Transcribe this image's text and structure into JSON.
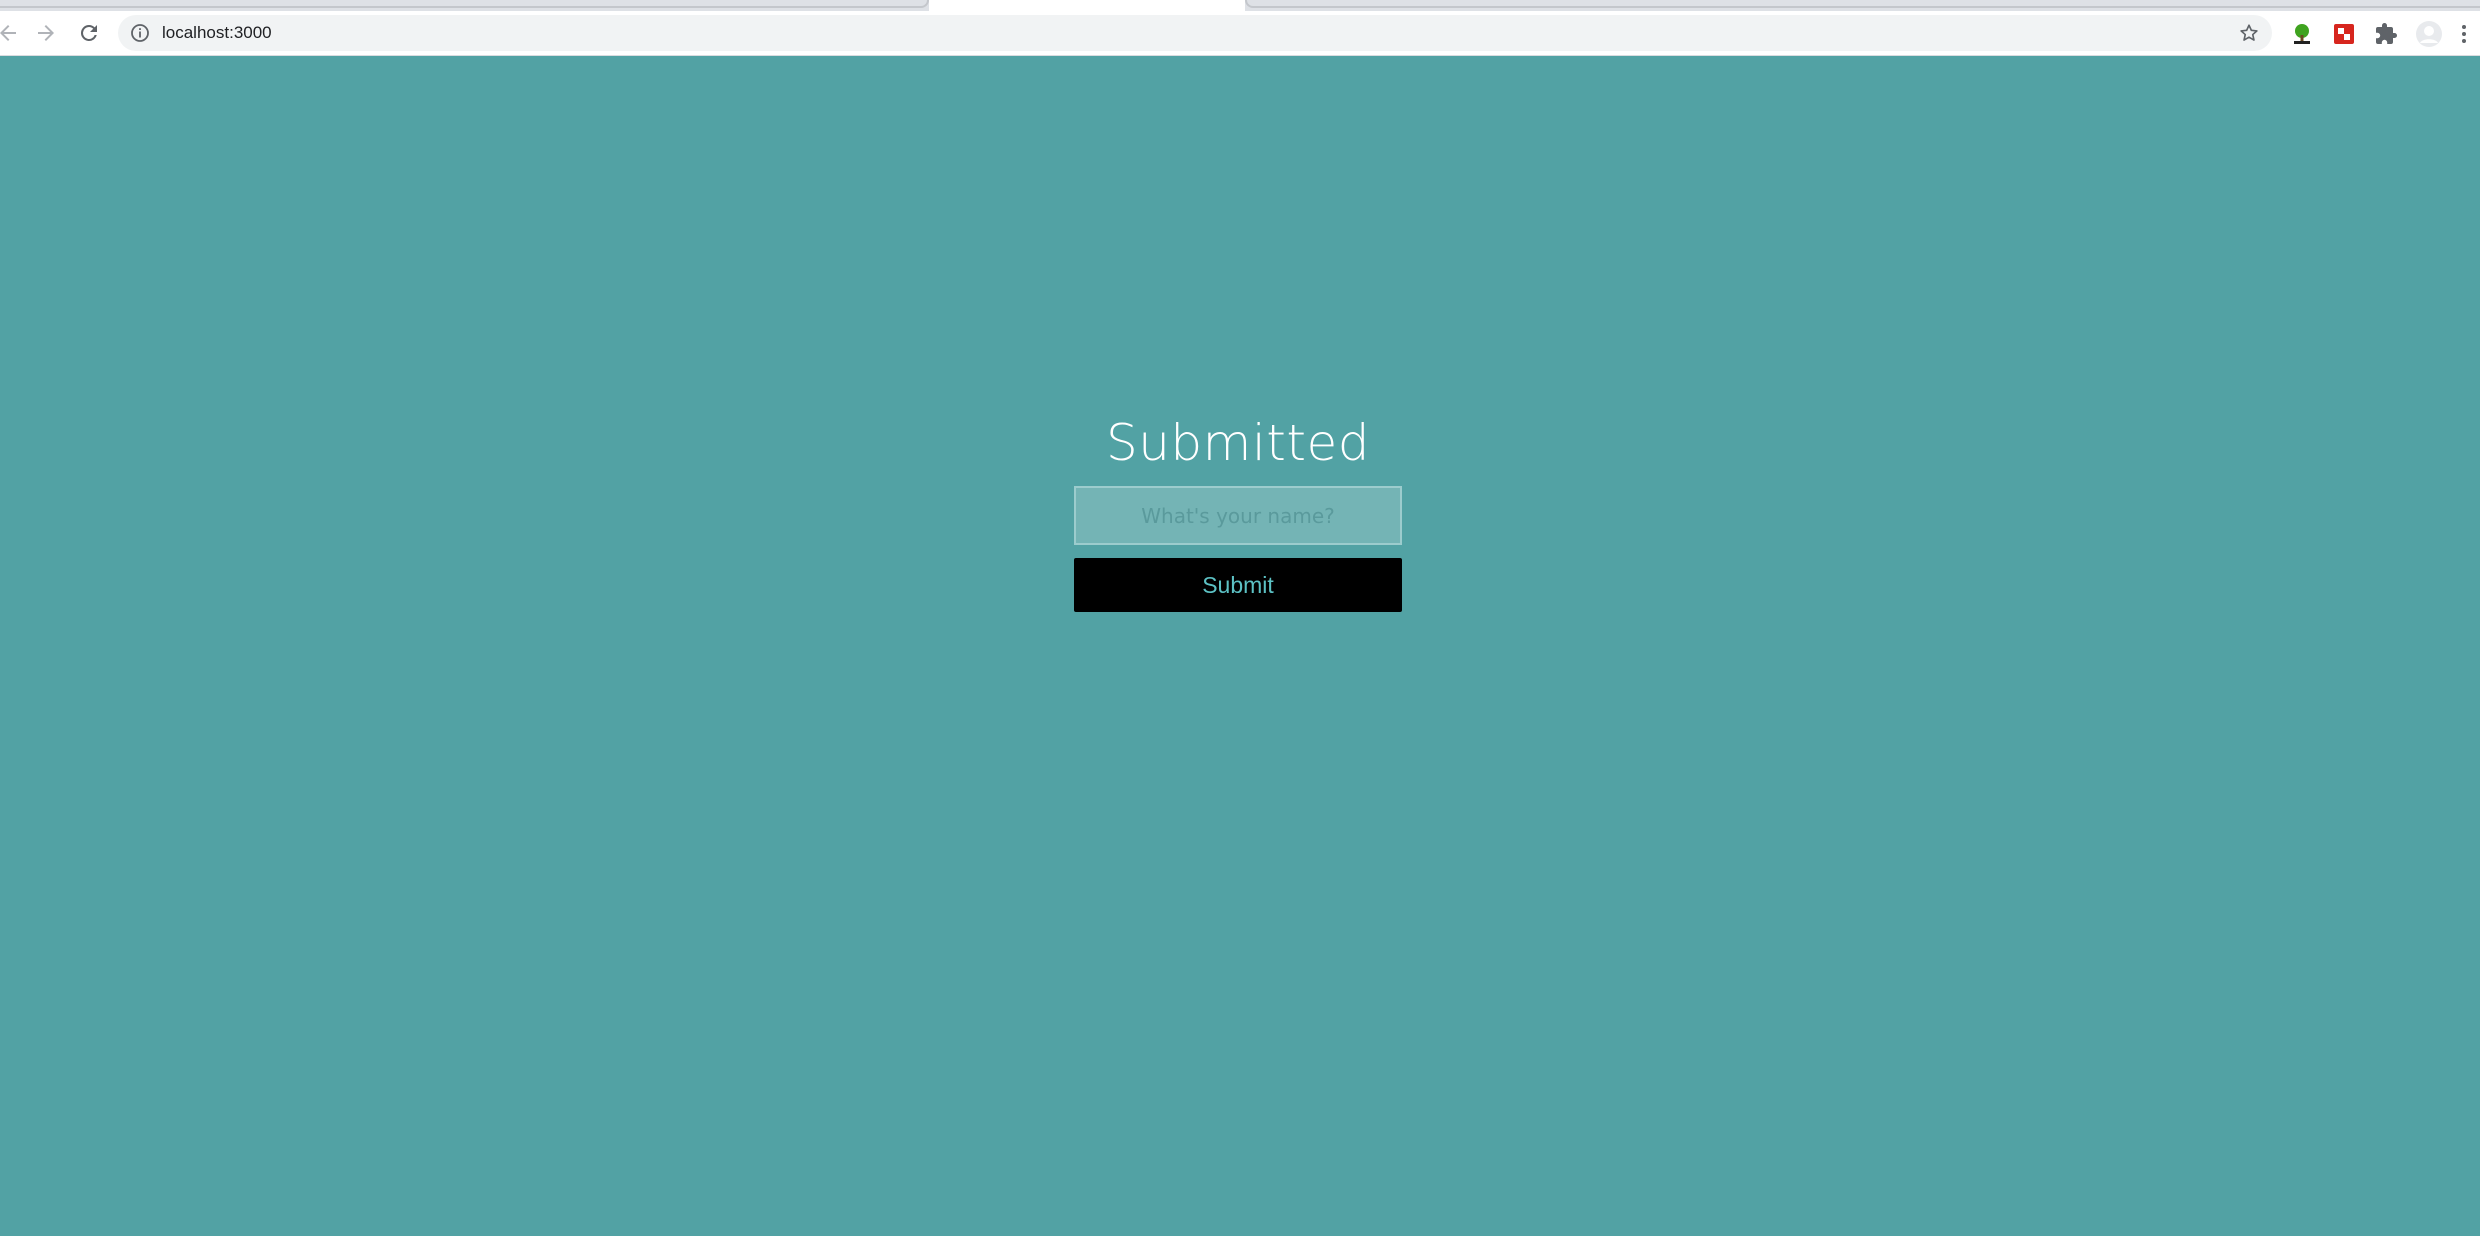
{
  "browser": {
    "url": "localhost:3000",
    "icons": {
      "back": "arrow-left-icon",
      "forward": "arrow-right-icon",
      "reload": "reload-icon",
      "info": "info-icon",
      "bookmark": "star-icon",
      "extension_1": "tree-extension-icon",
      "extension_2": "red-extension-icon",
      "extensions_menu": "puzzle-icon",
      "profile": "profile-avatar-icon",
      "menu": "kebab-menu-icon"
    }
  },
  "page": {
    "background_color": "#52a2a4",
    "title": "Submitted",
    "name_input": {
      "placeholder": "What's your name?",
      "value": ""
    },
    "submit_label": "Submit",
    "colors": {
      "input_bg": "#74b4b5",
      "button_bg": "#000000",
      "button_text": "#5cc1c4"
    }
  }
}
